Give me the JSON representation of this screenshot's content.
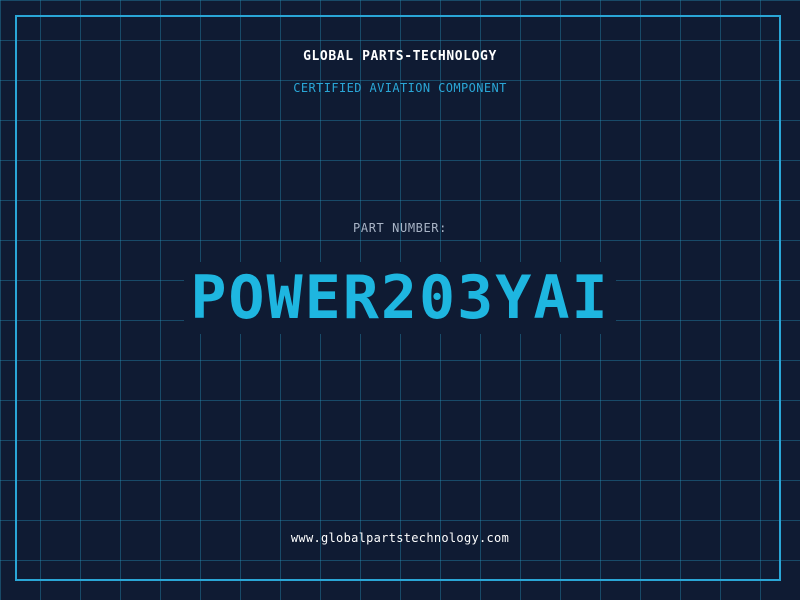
{
  "header": {
    "company_name": "GLOBAL PARTS-TECHNOLOGY",
    "tagline": "CERTIFIED AVIATION COMPONENT"
  },
  "part": {
    "label": "PART NUMBER:",
    "number": "POWER203YAI"
  },
  "footer": {
    "website": "www.globalpartstechnology.com"
  },
  "colors": {
    "background": "#0f1b33",
    "accent": "#2aa6d6",
    "part_number": "#1eb6e0",
    "label": "#a9b4c6",
    "text": "#ffffff"
  }
}
